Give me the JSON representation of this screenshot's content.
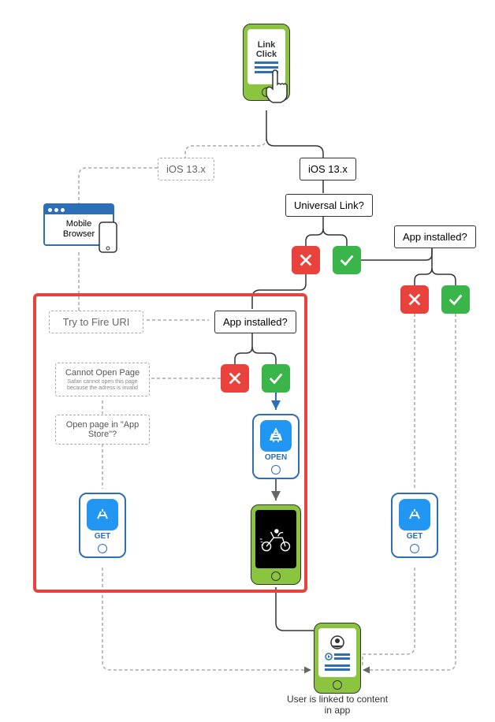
{
  "start": {
    "label": "Link\nClick"
  },
  "nodes": {
    "ios_left": "iOS 13.x",
    "ios_right": "iOS 13.x",
    "universal_link": "Universal Link?",
    "app_installed_right": "App installed?",
    "app_installed_center": "App installed?",
    "try_fire_uri": "Try to Fire URI"
  },
  "messages": {
    "cannot_open": {
      "title": "Cannot Open Page",
      "sub": "Safari cannot open this page because the adress is invalid"
    },
    "open_appstore": "Open page in \"App Store\"?"
  },
  "browser": {
    "label": "Mobile\nBrowser"
  },
  "phone_labels": {
    "open": "OPEN",
    "get": "GET"
  },
  "caption": "User is linked to content in app",
  "colors": {
    "green": "#8bc53f",
    "blue": "#2d6fb6",
    "red": "#e9413b",
    "pass": "#3ab54a",
    "appblue": "#2196f3"
  }
}
